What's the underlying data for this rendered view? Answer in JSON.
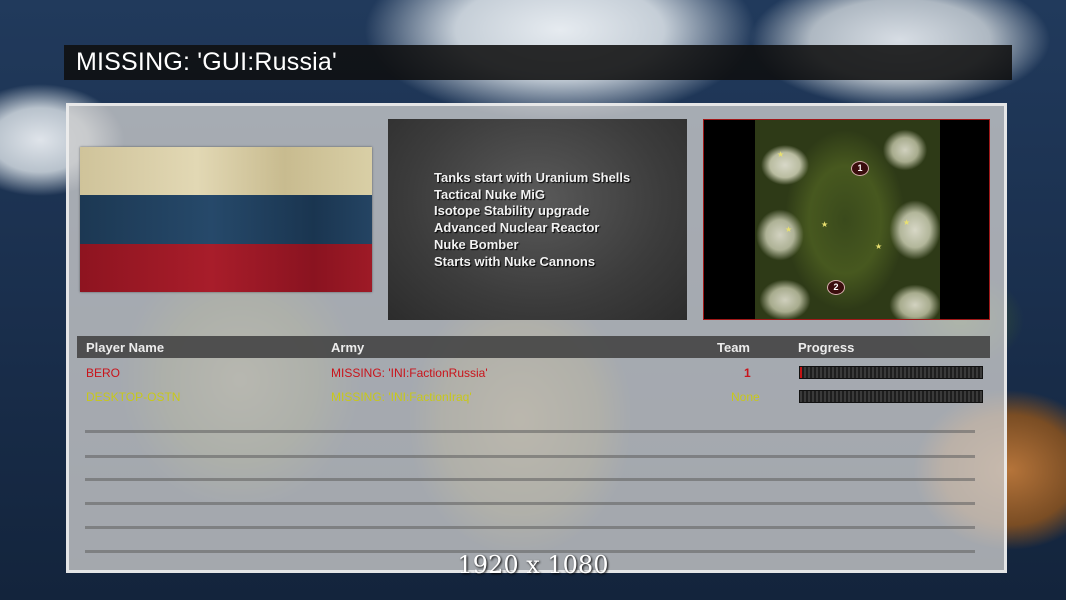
{
  "title": "MISSING: 'GUI:Russia'",
  "faction_features": [
    "Tanks start with Uranium Shells",
    "Tactical Nuke MiG",
    "Isotope Stability upgrade",
    "Advanced Nuclear Reactor",
    "Nuke Bomber",
    "Starts with Nuke Cannons"
  ],
  "minimap": {
    "start_positions": [
      "1",
      "2"
    ]
  },
  "table": {
    "headers": {
      "player_name": "Player Name",
      "army": "Army",
      "team": "Team",
      "progress": "Progress"
    },
    "rows": [
      {
        "player_name": "BERO",
        "army": "MISSING: 'INI:FactionRussia'",
        "team": "1",
        "progress": 0.01,
        "color": "#c9141b"
      },
      {
        "player_name": "DESKTOP-OSTN",
        "army": "MISSING: 'INI:FactionIraq'",
        "team": "None",
        "progress": 0.0,
        "color": "#c8c81a"
      }
    ]
  },
  "resolution_label": "1920 x 1080",
  "colors": {
    "player1": "#c9141b",
    "player2": "#c8c81a",
    "minimap_border": "#a01818"
  }
}
